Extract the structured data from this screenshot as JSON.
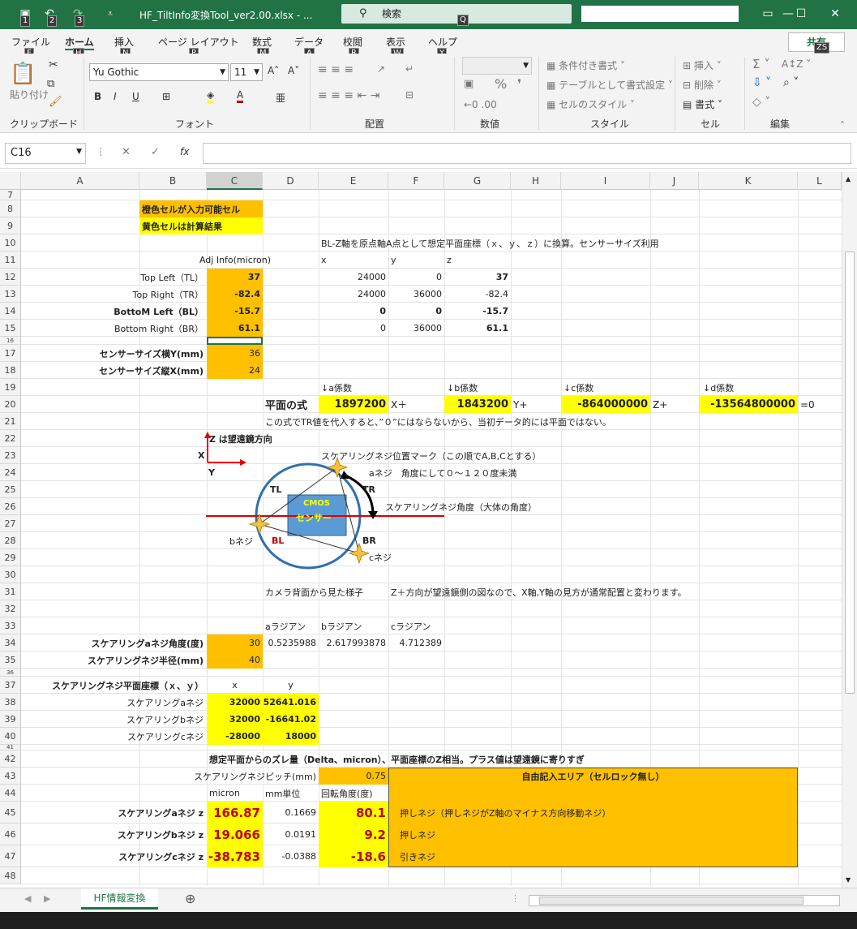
{
  "title": "HF_TiltInfo変換Tool_ver2.00.xlsx  -  ...",
  "search_label": "検索",
  "keytips": {
    "qat1": "1",
    "qat2": "2",
    "qat3": "3",
    "search": "Q",
    "share": "ZS",
    "file": "F",
    "home": "H",
    "insert": "N",
    "layout": "P",
    "formulas": "M",
    "data": "A",
    "review": "R",
    "view": "W",
    "help": "Y"
  },
  "tabs": [
    "ファイル",
    "ホーム",
    "挿入",
    "ページ レイアウト",
    "数式",
    "データ",
    "校閲",
    "表示",
    "ヘルプ"
  ],
  "share_label": "共有",
  "ribbon": {
    "paste": "貼り付け",
    "font_name": "Yu Gothic",
    "font_size": "11",
    "conditional": "条件付き書式",
    "table": "テーブルとして書式設定",
    "cellstyle": "セルのスタイル",
    "insert": "挿入",
    "delete": "削除",
    "format": "書式",
    "groups": [
      "クリップボード",
      "フォント",
      "配置",
      "数値",
      "スタイル",
      "セル",
      "編集"
    ]
  },
  "namebox": "C16",
  "fx": "fx",
  "columns": [
    "A",
    "B",
    "C",
    "D",
    "E",
    "F",
    "G",
    "H",
    "I",
    "J",
    "K",
    "L"
  ],
  "rows": [
    "7",
    "8",
    "9",
    "10",
    "11",
    "12",
    "13",
    "14",
    "15",
    "16",
    "17",
    "18",
    "19",
    "20",
    "21",
    "22",
    "23",
    "24",
    "25",
    "26",
    "27",
    "28",
    "29",
    "30",
    "31",
    "32",
    "33",
    "34",
    "35",
    "36",
    "37",
    "38",
    "39",
    "40",
    "41",
    "42",
    "43",
    "44",
    "45",
    "46",
    "47",
    "48"
  ],
  "cells": {
    "b8": "橙色セルが入力可能セル",
    "b9": "黄色セルは計算結果",
    "e10": "BL-Z軸を原点軸A点として想定平面座標（ｘ、ｙ、ｚ）に換算。センサーサイズ利用",
    "c11": "Adj Info(micron)",
    "e11": "x",
    "f11": "y",
    "g11": "z",
    "b12": "Top Left（TL）",
    "c12": "37",
    "e12": "24000",
    "f12": "0",
    "g12": "37",
    "b13": "Top Right（TR）",
    "c13": "-82.4",
    "e13": "24000",
    "f13": "36000",
    "g13": "-82.4",
    "b14": "BottoM Left（BL）",
    "c14": "-15.7",
    "e14": "0",
    "f14": "0",
    "g14": "-15.7",
    "b15": "Bottom Right（BR）",
    "c15": "61.1",
    "e15": "0",
    "f15": "36000",
    "g15": "61.1",
    "b17": "センサーサイズ横Y(mm)",
    "c17": "36",
    "b18": "センサーサイズ縦X(mm)",
    "c18": "24",
    "e19": "↓a係数",
    "g19": "↓b係数",
    "i19": "↓c係数",
    "k19": "↓d係数",
    "d20": "平面の式",
    "e20": "1897200",
    "f20": "X＋",
    "g20": "1843200",
    "h20": "Y+",
    "i20": "-864000000",
    "j20": "Z+",
    "k20": "-13564800000",
    "l20": "=0",
    "d21": "この式でTR値を代入すると、”０”にはならないから、当初データ的には平面ではない。",
    "c22": "Z は望遠鏡方向",
    "x_label": "X",
    "y_label": "Y",
    "e23": "スケアリングネジ位置マーク（この順でA,B,Cとする）",
    "f24": "aネジ　角度にして０～１２０度未満",
    "tl": "TL",
    "tr": "TR",
    "bl": "BL",
    "br": "BR",
    "cmos1": "CMOS",
    "cmos2": "センサー",
    "g26": "スケアリングネジ角度（大体の角度）",
    "bneji": "bネジ",
    "cneji": "cネジ",
    "d31": "カメラ背面から見た様子",
    "f31": "Z＋方向が望遠鏡側の図なので、X軸,Y軸の見方が通常配置と変わります。",
    "d33": "aラジアン",
    "e33": "bラジアン",
    "f33": "cラジアン",
    "b34": "スケアリングaネジ角度(度)",
    "c34": "30",
    "d34": "0.5235988",
    "e34": "2.617993878",
    "f34": "4.712389",
    "b35": "スケアリングネジ半径(mm)",
    "c35": "40",
    "b37": "スケアリングネジ平面座標（ｘ、ｙ）",
    "c37": "x",
    "d37": "y",
    "b38": "スケアリングaネジ",
    "c38": "32000",
    "d38": "52641.016",
    "b39": "スケアリングbネジ",
    "c39": "32000",
    "d39": "-16641.02",
    "b40": "スケアリングcネジ",
    "c40": "-28000",
    "d40": "18000",
    "c42": "想定平面からのズレ量（Delta、micron）、平面座標のZ相当。プラス値は望遠鏡に寄りすぎ",
    "b43": "スケアリングネジピッチ(mm)",
    "e43": "0.75",
    "free": "自由記入エリア（セルロック無し）",
    "c44": "micron",
    "d44": "mm単位",
    "e44": "回転角度(度)",
    "b45": "スケアリングaネジ z",
    "c45": "166.87",
    "d45": "0.1669",
    "e45": "80.1",
    "f45": "押しネジ（押しネジがZ軸のマイナス方向移動ネジ）",
    "b46": "スケアリングbネジ z",
    "c46": "19.066",
    "d46": "0.0191",
    "e46": "9.2",
    "f46": "押しネジ",
    "b47": "スケアリングcネジ z",
    "c47": "-38.783",
    "d47": "-0.0388",
    "e47": "-18.6",
    "f47": "引きネジ"
  },
  "sheet_tab": "HF情報変換",
  "colors": {
    "excel_green": "#217346",
    "orange": "#ffc000",
    "yellow": "#ffff00",
    "red": "#c00000"
  },
  "icons": [
    "undo-icon",
    "redo-icon",
    "save-icon",
    "search-icon",
    "cut-icon",
    "copy-icon",
    "format-painter-icon",
    "bold-icon",
    "italic-icon",
    "underline-icon",
    "fill-color-icon",
    "font-color-icon",
    "align-icon",
    "percent-icon",
    "comma-icon",
    "sum-icon",
    "sort-icon",
    "find-icon",
    "clear-icon",
    "add-sheet-icon"
  ]
}
